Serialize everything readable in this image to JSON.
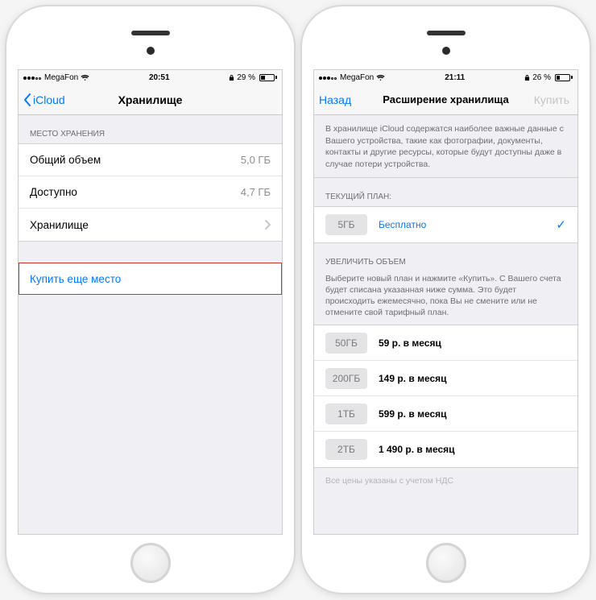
{
  "left": {
    "status": {
      "carrier": "MegaFon",
      "time": "20:51",
      "battery": "29 %"
    },
    "nav": {
      "back": "iCloud",
      "title": "Хранилище"
    },
    "storage_header": "МЕСТО ХРАНЕНИЯ",
    "rows": {
      "total_label": "Общий объем",
      "total_value": "5,0 ГБ",
      "avail_label": "Доступно",
      "avail_value": "4,7 ГБ",
      "manage_label": "Хранилище"
    },
    "buy_more": "Купить еще место"
  },
  "right": {
    "status": {
      "carrier": "MegaFon",
      "time": "21:11",
      "battery": "26 %"
    },
    "nav": {
      "back": "Назад",
      "title": "Расширение хранилища",
      "action": "Купить"
    },
    "description": "В хранилище iCloud содержатся наиболее важные данные с Вашего устройства, такие как фотографии, документы, контакты и другие ресурсы, которые будут доступны даже в случае потери устройства.",
    "current_header": "ТЕКУЩИЙ ПЛАН:",
    "current_plan": {
      "size": "5ГБ",
      "price": "Бесплатно"
    },
    "upgrade_header": "УВЕЛИЧИТЬ ОБЪЕМ",
    "upgrade_sub": "Выберите новый план и нажмите «Купить». С Вашего счета будет списана указанная ниже сумма. Это будет происходить ежемесячно, пока Вы не смените или не отмените свой тарифный план.",
    "plans": [
      {
        "size": "50ГБ",
        "price": "59 р. в месяц"
      },
      {
        "size": "200ГБ",
        "price": "149 р. в месяц"
      },
      {
        "size": "1ТБ",
        "price": "599 р. в месяц"
      },
      {
        "size": "2ТБ",
        "price": "1 490 р. в месяц"
      }
    ],
    "footer_note": "Все цены указаны с учетом НДС"
  }
}
